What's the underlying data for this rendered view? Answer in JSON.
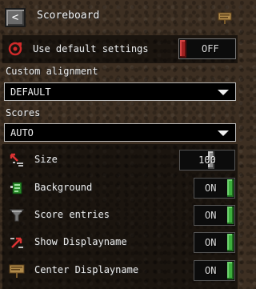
{
  "header": {
    "back_symbol": "<",
    "title": "Scoreboard",
    "back_icon": "chevron-left-icon",
    "right_icon": "sign-icon"
  },
  "default_settings": {
    "label": "Use default settings",
    "value": "OFF",
    "icon": "reset-icon"
  },
  "alignment": {
    "label": "Custom alignment",
    "value": "DEFAULT"
  },
  "scores": {
    "label": "Scores",
    "value": "AUTO"
  },
  "settings": [
    {
      "label": "Size",
      "value": "100",
      "icon": "size-arrows-icon",
      "level": 0.62
    },
    {
      "label": "Background",
      "value": "ON",
      "icon": "background-icon"
    },
    {
      "label": "Score entries",
      "value": "ON",
      "icon": "funnel-icon"
    },
    {
      "label": "Show Displayname",
      "value": "ON",
      "icon": "displayname-arrow-icon"
    },
    {
      "label": "Center Displayname",
      "value": "ON",
      "icon": "sign-icon"
    }
  ],
  "colors": {
    "on_green": "#3cae3c",
    "off_red": "#a02020",
    "background": "#3d2f22"
  }
}
